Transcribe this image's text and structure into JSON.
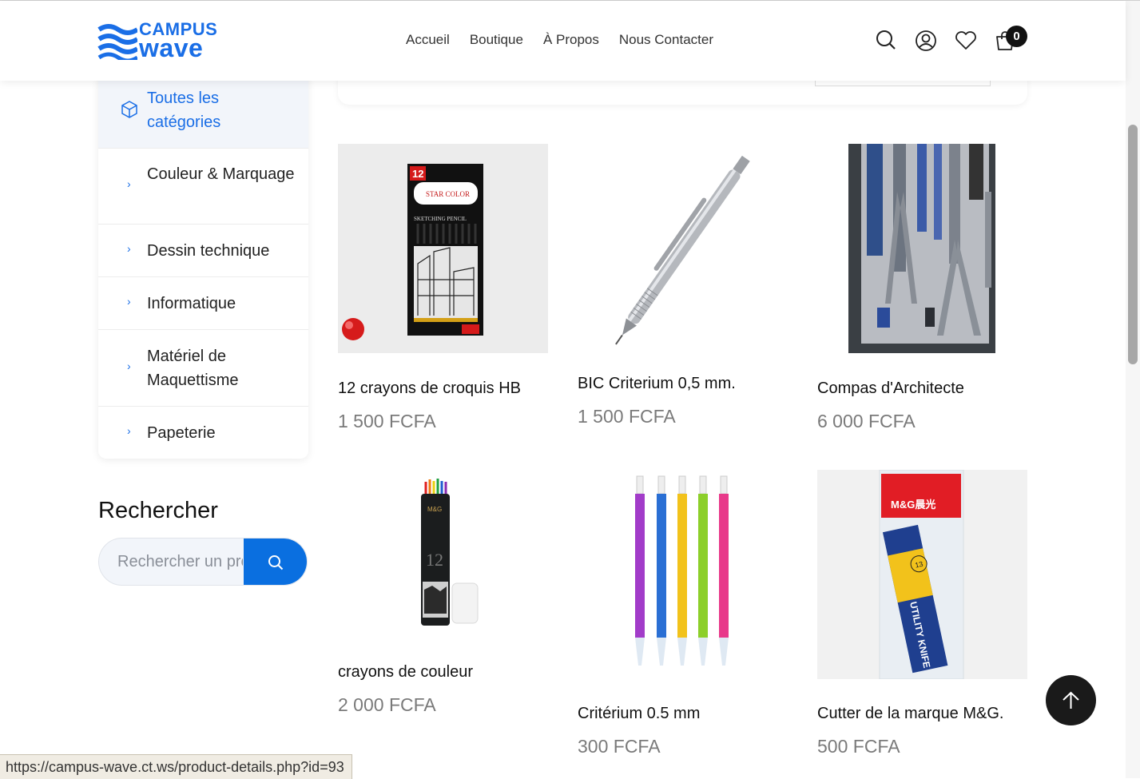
{
  "header": {
    "logo_top": "CAMPUS",
    "logo_bottom": "wave",
    "nav": [
      "Accueil",
      "Boutique",
      "À Propos",
      "Nous Contacter"
    ],
    "cart_count": "0",
    "icons": [
      "search-icon",
      "user-icon",
      "heart-icon",
      "cart-icon"
    ],
    "accent_color": "#1a6ee6"
  },
  "sidebar": {
    "all_categories": "Toutes les catégories",
    "categories": [
      "Couleur & Marquage",
      "Dessin technique",
      "Informatique",
      "Matériel de Maquettisme",
      "Papeterie"
    ],
    "search_title": "Rechercher",
    "search_placeholder": "Rechercher un produit"
  },
  "products": [
    {
      "name": "12 crayons de croquis HB",
      "price": "1 500 FCFA"
    },
    {
      "name": "BIC Criterium 0,5 mm.",
      "price": "1 500 FCFA"
    },
    {
      "name": "Compas d'Architecte",
      "price": "6 000 FCFA"
    },
    {
      "name": "crayons de couleur",
      "price": "2 000 FCFA"
    },
    {
      "name": "Critérium 0.5 mm",
      "price": "300 FCFA"
    },
    {
      "name": "Cutter de la marque M&G.",
      "price": "500 FCFA"
    }
  ],
  "product_images": {
    "p1_box_number": "12",
    "p1_box_title": "STAR COLOR",
    "p1_box_subtitle": "SKETCHING PENCIL",
    "p4_tube_brand": "M&G",
    "p4_tube_number": "12",
    "p6_brand": "M&G晨光",
    "p6_label": "UTILITY KNIFE",
    "p6_count": "13"
  },
  "status_url": "https://campus-wave.ct.ws/product-details.php?id=93"
}
